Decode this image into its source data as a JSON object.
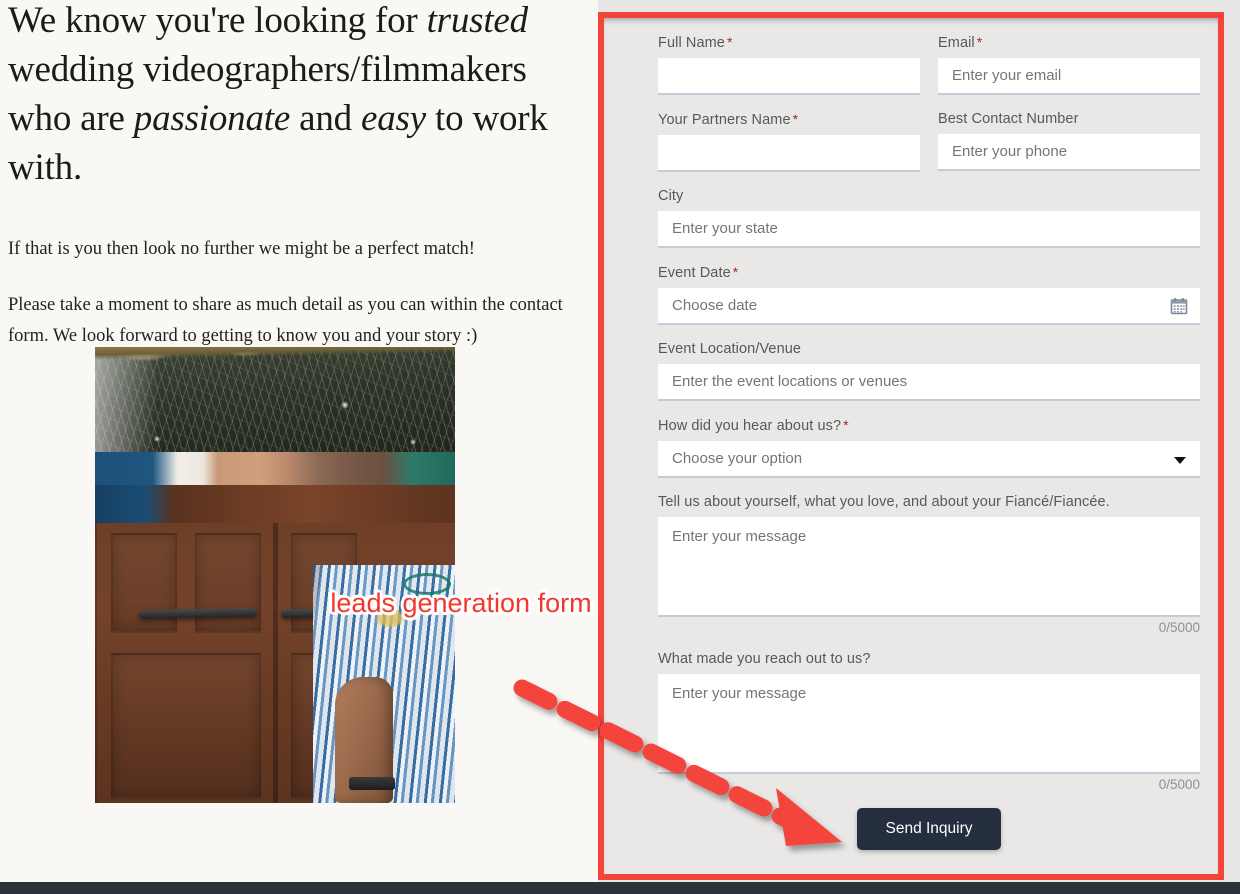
{
  "left": {
    "headline_parts": [
      {
        "text": "We know you're looking for ",
        "italic": false
      },
      {
        "text": "trusted",
        "italic": true
      },
      {
        "text": " wedding videographers/filmmakers who are ",
        "italic": false
      },
      {
        "text": "passionate",
        "italic": true
      },
      {
        "text": " and ",
        "italic": false
      },
      {
        "text": "easy",
        "italic": true
      },
      {
        "text": " to work with.",
        "italic": false
      }
    ],
    "headline_plain": "We know you're looking for trusted wedding videographers/filmmakers who are passionate and easy to work with.",
    "paragraph_1": "If that is you then look no further we might be a perfect match!",
    "paragraph_2": "Please take a moment to share as much detail as you can within the contact form. We look forward to getting to know you and your story :)"
  },
  "annotation": {
    "label": "leads generation form",
    "box_color": "#f4453c",
    "arrow_color": "#f4453c",
    "label_color": "#f4372c",
    "label_outline_color": "#ffffff"
  },
  "form": {
    "fields": [
      {
        "id": "full-name",
        "label": "Full Name",
        "required": true,
        "placeholder": "",
        "value": "",
        "type": "text",
        "width": "half"
      },
      {
        "id": "email",
        "label": "Email",
        "required": true,
        "placeholder": "Enter your email",
        "value": "",
        "type": "text",
        "width": "half"
      },
      {
        "id": "partners-name",
        "label": "Your Partners Name",
        "required": true,
        "placeholder": "",
        "value": "",
        "type": "text",
        "width": "half"
      },
      {
        "id": "contact-number",
        "label": "Best Contact Number",
        "required": false,
        "placeholder": "Enter your phone",
        "value": "",
        "type": "text",
        "width": "half"
      },
      {
        "id": "city",
        "label": "City",
        "required": false,
        "placeholder": "Enter your state",
        "value": "",
        "type": "text",
        "width": "full"
      },
      {
        "id": "event-date",
        "label": "Event Date",
        "required": true,
        "placeholder": "Choose date",
        "value": "",
        "type": "date",
        "icon": "calendar-icon",
        "width": "full"
      },
      {
        "id": "event-location",
        "label": "Event Location/Venue",
        "required": false,
        "placeholder": "Enter the event locations or venues",
        "value": "",
        "type": "text",
        "width": "full"
      },
      {
        "id": "how-did-you-hear",
        "label": "How did you hear about us?",
        "required": true,
        "placeholder": "Choose your option",
        "value": "Choose your option",
        "type": "select",
        "icon": "chevron-down-icon",
        "width": "full"
      },
      {
        "id": "about-yourself",
        "label": "Tell us about yourself, what you love, and about your Fiancé/Fiancée.",
        "required": false,
        "placeholder": "Enter your message",
        "value": "",
        "type": "textarea",
        "counter": "0/5000",
        "width": "full"
      },
      {
        "id": "why-reach-out",
        "label": "What made you reach out to us?",
        "required": false,
        "placeholder": "Enter your message",
        "value": "",
        "type": "textarea",
        "counter": "0/5000",
        "width": "full"
      }
    ],
    "required_marker": "*",
    "submit_label": "Send Inquiry",
    "submit_color": "#242e3e"
  },
  "colors": {
    "page_background": "#faf8f4",
    "form_background": "#e9e8e6",
    "input_background": "#ffffff",
    "input_underline": "#c5cbd8",
    "label_text": "#55585f",
    "placeholder_text": "#72757c",
    "required_asterisk": "#a32b2b",
    "counter_text": "#8e9096",
    "bottom_bar": "#2b323c"
  }
}
